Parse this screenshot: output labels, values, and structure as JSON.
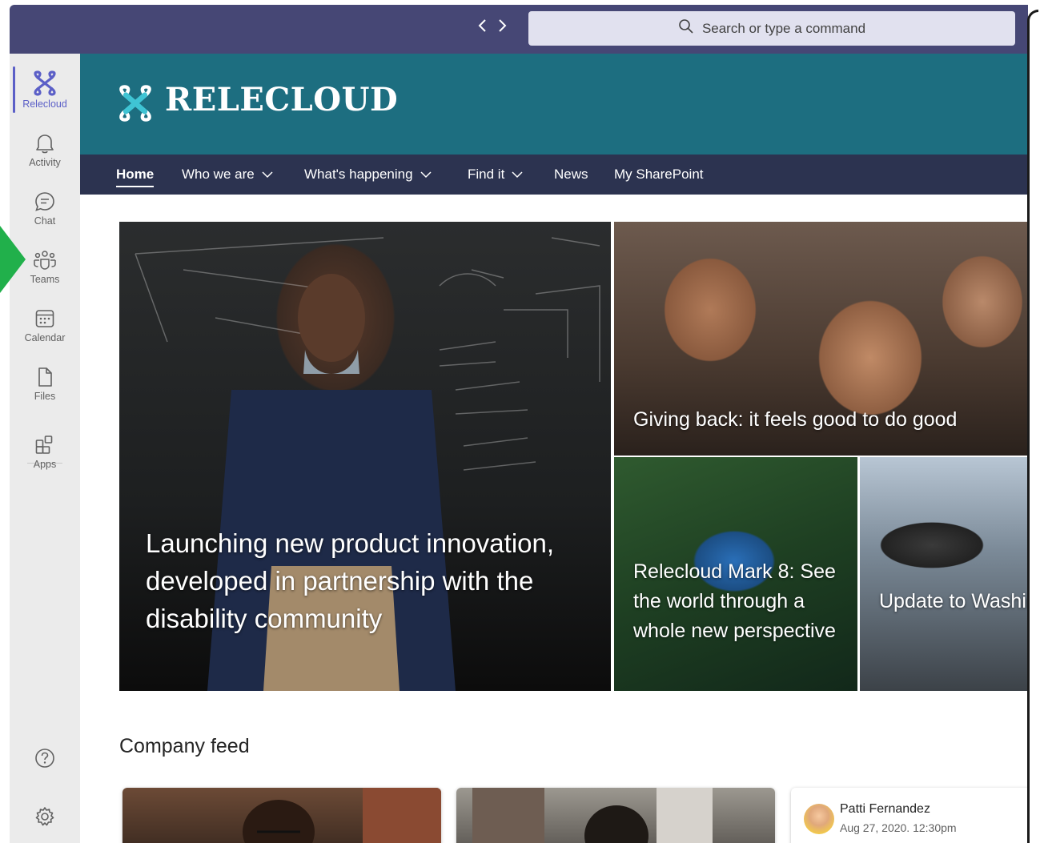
{
  "titlebar": {
    "back_icon": "chevron-left",
    "forward_icon": "chevron-right",
    "search_placeholder": "Search or type a command"
  },
  "rail": {
    "items": [
      {
        "label": "Relecloud",
        "icon": "relecloud-logo",
        "active": true
      },
      {
        "label": "Activity",
        "icon": "bell"
      },
      {
        "label": "Chat",
        "icon": "chat-bubble"
      },
      {
        "label": "Teams",
        "icon": "people-group"
      },
      {
        "label": "Calendar",
        "icon": "calendar"
      },
      {
        "label": "Files",
        "icon": "document"
      },
      {
        "label": "Apps",
        "icon": "apps-grid"
      }
    ],
    "bottom": [
      {
        "icon": "help-circle"
      },
      {
        "icon": "gear"
      }
    ]
  },
  "site": {
    "name": "RELECLOUD",
    "brand_color": "#1d6e80",
    "nav_color": "#2c3350"
  },
  "nav": [
    {
      "label": "Home",
      "active": true
    },
    {
      "label": "Who we are",
      "dropdown": true
    },
    {
      "label": "What's happening",
      "dropdown": true
    },
    {
      "label": "Find it",
      "dropdown": true
    },
    {
      "label": "News"
    },
    {
      "label": "My SharePoint"
    }
  ],
  "hero": {
    "main_title": "Launching new product innovation, developed in partnership with the disability community",
    "tile_kids": "Giving back: it feels good to do good",
    "tile_forest": "Relecloud Mark 8: See the world through a whole new perspective",
    "tile_bike": "Update to Washington Dro Laws"
  },
  "feed": {
    "heading": "Company feed",
    "post": {
      "author": "Patti Fernandez",
      "time": "Aug 27, 2020. 12:30pm"
    }
  }
}
